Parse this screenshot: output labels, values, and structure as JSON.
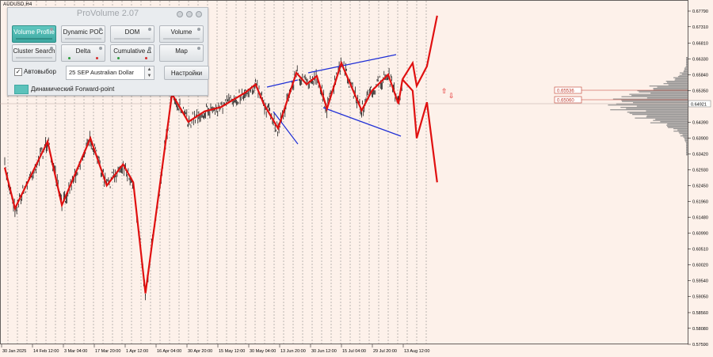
{
  "chart": {
    "symbol": "AUDUSD,H4",
    "current_price": "0.64921",
    "level_labels": [
      "0.65536",
      "0.65060"
    ],
    "price_labels": [
      "0.67790",
      "0.67310",
      "0.66810",
      "0.66330",
      "0.65840",
      "0.65350",
      "0.64921",
      "0.64390",
      "0.63900",
      "0.63420",
      "0.62930",
      "0.62450",
      "0.61960",
      "0.61480",
      "0.60990",
      "0.60510",
      "0.60020",
      "0.59540",
      "0.59050",
      "0.58560",
      "0.58080",
      "0.57590"
    ],
    "time_labels": [
      "30 Jan 2025",
      "14 Feb 12:00",
      "3 Mar 04:00",
      "17 Mar 20:00",
      "1 Apr 12:00",
      "16 Apr 04:00",
      "30 Apr 20:00",
      "15 May 12:00",
      "30 May 04:00",
      "13 Jun 20:00",
      "30 Jun 12:00",
      "15 Jul 04:00",
      "29 Jul 20:00",
      "13 Aug 12:00"
    ],
    "colors": {
      "background": "#fdf1ea",
      "zigzag": "#e01010",
      "trend_lines": "#1f2fd6",
      "candles": "#000000",
      "grid": "#7a7a7a",
      "volume_profile": "#8a8a8a"
    }
  },
  "chart_data": {
    "type": "line",
    "title": "AUDUSD,H4",
    "xlabel": "",
    "ylabel": "",
    "ylim": [
      0.5759,
      0.6779
    ],
    "series": [
      {
        "name": "",
        "x": [
          "30 Jan",
          "4 Feb",
          "20 Feb",
          "27 Feb",
          "13 Mar",
          "21 Mar",
          "29 Mar",
          "3 Apr",
          "9 Apr",
          "22 Apr",
          "30 Apr",
          "8 May",
          "16 May",
          "28 May",
          "2 Jun",
          "6 Jun",
          "13 Jun",
          "22 Jun",
          "27 Jun",
          "2 Jul",
          "7 Jul",
          "14 Jul",
          "24 Jul",
          "29 Jul",
          "6 Aug",
          "11 Aug",
          "13 Aug"
        ],
        "values": [
          0.63,
          0.6175,
          0.638,
          0.6185,
          0.639,
          0.6245,
          0.631,
          0.6255,
          0.5915,
          0.6525,
          0.644,
          0.6472,
          0.6485,
          0.653,
          0.6555,
          0.6495,
          0.642,
          0.659,
          0.6555,
          0.658,
          0.648,
          0.662,
          0.6475,
          0.6535,
          0.6585,
          0.6495,
          0.657
        ]
      },
      {
        "name": "",
        "x": [
          "13 Aug",
          "18 Aug",
          "20 Aug",
          "25 Aug",
          "30 Aug"
        ],
        "values": [
          0.657,
          0.662,
          0.655,
          0.661,
          0.6765
        ]
      },
      {
        "name": "",
        "x": [
          "13 Aug",
          "18 Aug",
          "20 Aug",
          "25 Aug",
          "30 Aug"
        ],
        "values": [
          0.657,
          0.6535,
          0.639,
          0.65,
          0.6255
        ]
      }
    ]
  },
  "panel": {
    "title": "ProVolume 2.07",
    "buttons": [
      {
        "label": "Volume Profile",
        "active": true
      },
      {
        "label": "Dynamic POC"
      },
      {
        "label": "DOM"
      },
      {
        "label": "Volume"
      },
      {
        "label": "Cluster Search"
      },
      {
        "label": "Delta"
      },
      {
        "label": "Cumulative Δ"
      },
      {
        "label": "Map"
      }
    ],
    "auto_label": "Автовыбор",
    "instrument": "25 SEP Australian Dollar",
    "settings_label": "Настройки",
    "forward_label": "Динамический Forward-point"
  }
}
